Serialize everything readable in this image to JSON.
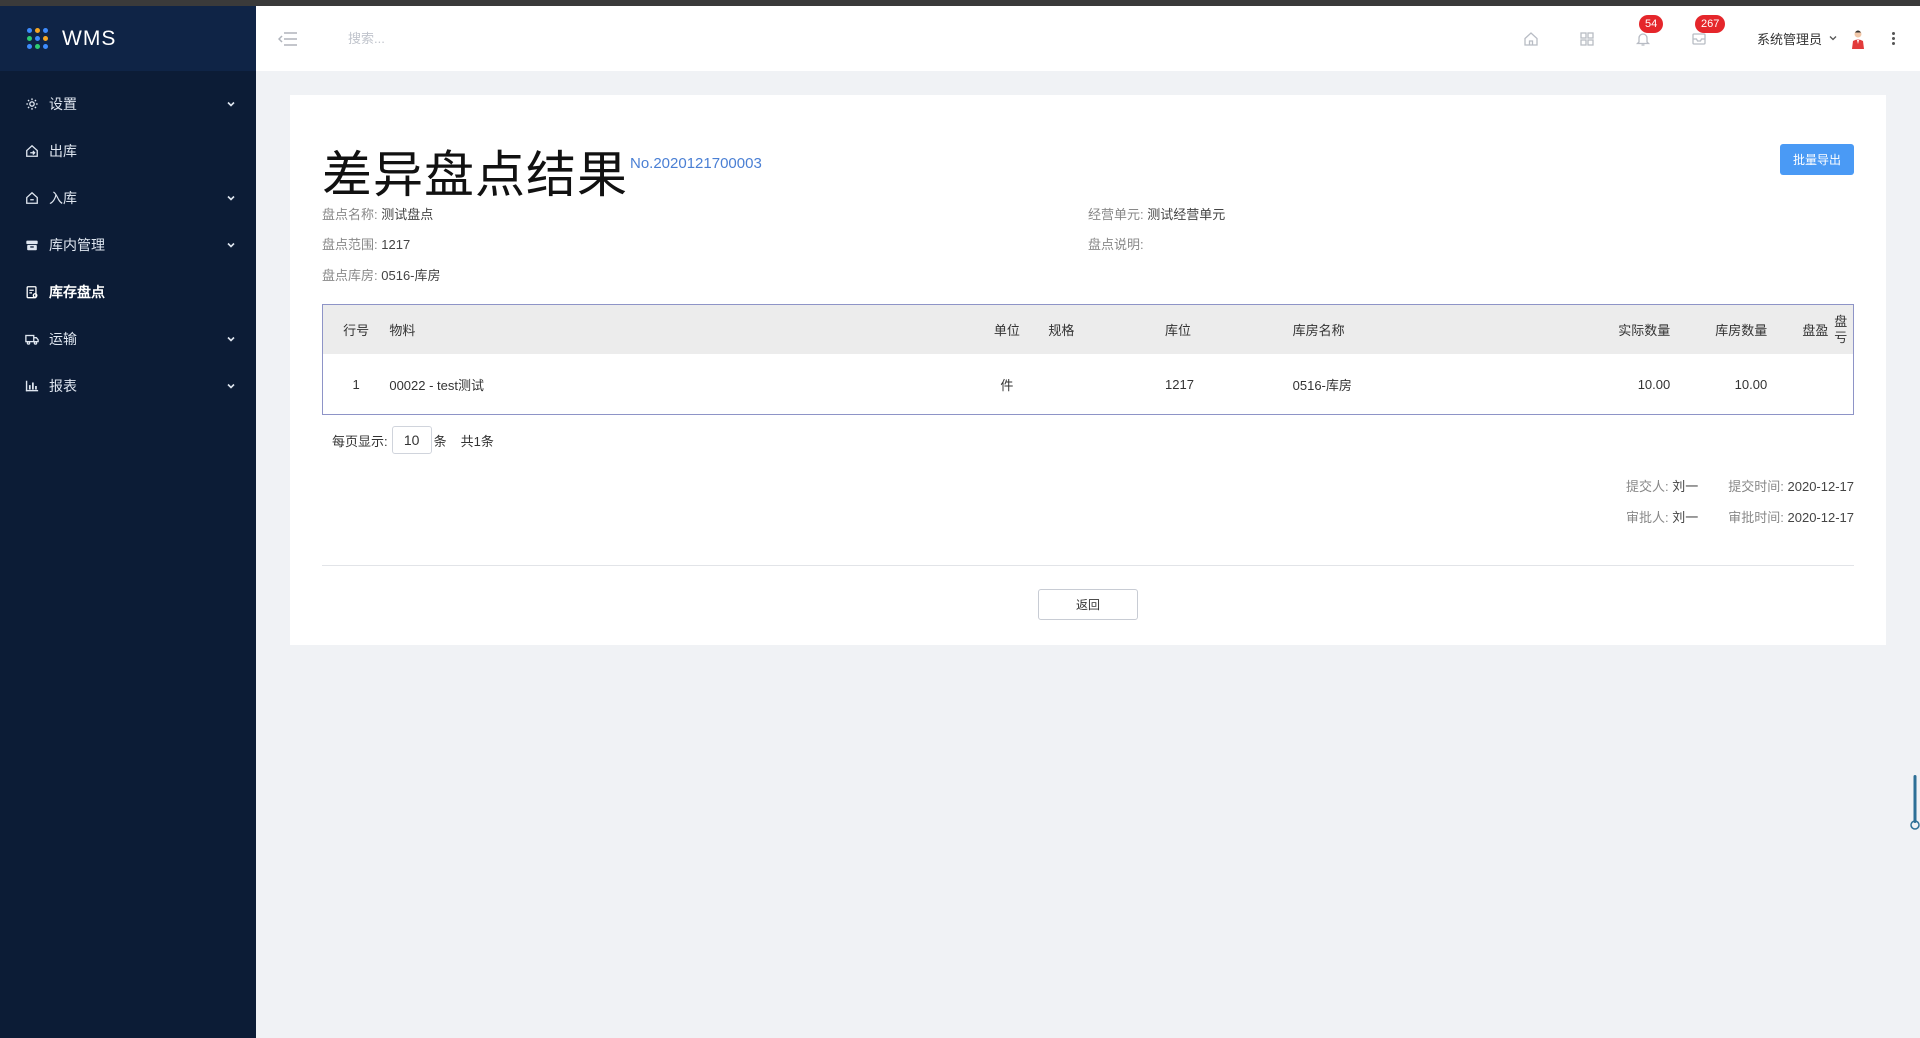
{
  "app": {
    "title": "WMS"
  },
  "sidebar": {
    "items": [
      {
        "label": "设置",
        "icon": "gear-icon",
        "has_children": true,
        "active": false
      },
      {
        "label": "出库",
        "icon": "home-out-icon",
        "has_children": false,
        "active": false
      },
      {
        "label": "入库",
        "icon": "home-in-icon",
        "has_children": true,
        "active": false
      },
      {
        "label": "库内管理",
        "icon": "box-icon",
        "has_children": true,
        "active": false
      },
      {
        "label": "库存盘点",
        "icon": "clipboard-icon",
        "has_children": false,
        "active": true
      },
      {
        "label": "运输",
        "icon": "truck-icon",
        "has_children": true,
        "active": false
      },
      {
        "label": "报表",
        "icon": "bar-chart-icon",
        "has_children": true,
        "active": false
      }
    ]
  },
  "header": {
    "search_placeholder": "搜索...",
    "notification_count": "54",
    "message_count": "267",
    "user_name": "系统管理员"
  },
  "page": {
    "title": "差异盘点结果",
    "order_no": "No.2020121700003",
    "export_label": "批量导出",
    "info": {
      "name_key": "盘点名称:",
      "name_val": "测试盘点",
      "range_key": "盘点范围:",
      "range_val": "1217",
      "warehouse_key": "盘点库房:",
      "warehouse_val": "0516-库房",
      "unit_key": "经营单元:",
      "unit_val": "测试经营单元",
      "desc_key": "盘点说明:",
      "desc_val": ""
    },
    "table": {
      "headers": {
        "no": "行号",
        "material": "物料",
        "unit": "单位",
        "spec": "规格",
        "location": "库位",
        "warehouse": "库房名称",
        "actual": "实际数量",
        "stock": "库房数量",
        "profit": "盘盈",
        "loss": "盘亏"
      },
      "rows": [
        {
          "no": "1",
          "material": "00022 - test测试",
          "unit": "件",
          "spec": "",
          "location": "1217",
          "warehouse": "0516-库房",
          "actual": "10.00",
          "stock": "10.00",
          "profit": "",
          "loss": ""
        }
      ]
    },
    "pager": {
      "prefix": "每页显示:",
      "page_size": "10",
      "suffix": "条",
      "total": "共1条"
    },
    "meta": {
      "submitter_key": "提交人:",
      "submitter_val": "刘一",
      "submit_time_key": "提交时间:",
      "submit_time_val": "2020-12-17",
      "approver_key": "审批人:",
      "approver_val": "刘一",
      "approve_time_key": "审批时间:",
      "approve_time_val": "2020-12-17"
    },
    "back_label": "返回"
  }
}
